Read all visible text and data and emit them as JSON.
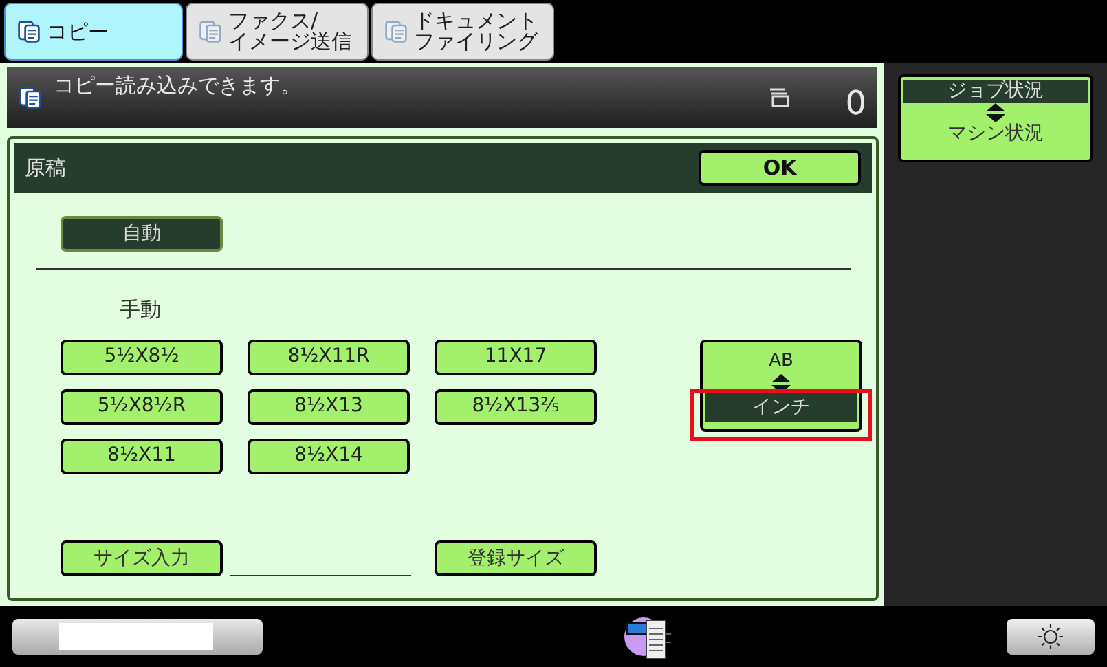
{
  "tabs": [
    {
      "lines": [
        "コピー"
      ],
      "selected": true
    },
    {
      "lines": [
        "ファクス/",
        "イメージ送信"
      ],
      "selected": false
    },
    {
      "lines": [
        "ドキュメント",
        "ファイリング"
      ],
      "selected": false
    }
  ],
  "status_bar": {
    "message": "コピー読み込みできます。",
    "count": "0"
  },
  "dialog": {
    "title": "原稿",
    "ok_button": "OK",
    "auto_button": {
      "label": "自動",
      "selected": true
    },
    "manual_label": "手動",
    "sizes": [
      {
        "label": "5½X8½",
        "selected": false
      },
      {
        "label": "8½X11R",
        "selected": false
      },
      {
        "label": "11X17",
        "selected": false
      },
      {
        "label": "5½X8½R",
        "selected": false
      },
      {
        "label": "8½X13",
        "selected": false
      },
      {
        "label": "8½X13⅖",
        "selected": false
      },
      {
        "label": "8½X11",
        "selected": false
      },
      {
        "label": "8½X14",
        "selected": false
      }
    ],
    "unit_toggle": [
      {
        "label": "AB",
        "selected": false,
        "highlighted": false
      },
      {
        "label": "インチ",
        "selected": true,
        "highlighted": true
      }
    ],
    "size_input_button": "サイズ入力",
    "registered_size_button": "登録サイズ"
  },
  "status_toggle": [
    {
      "label": "ジョブ状況",
      "selected": true
    },
    {
      "label": "マシン状況",
      "selected": false
    }
  ]
}
